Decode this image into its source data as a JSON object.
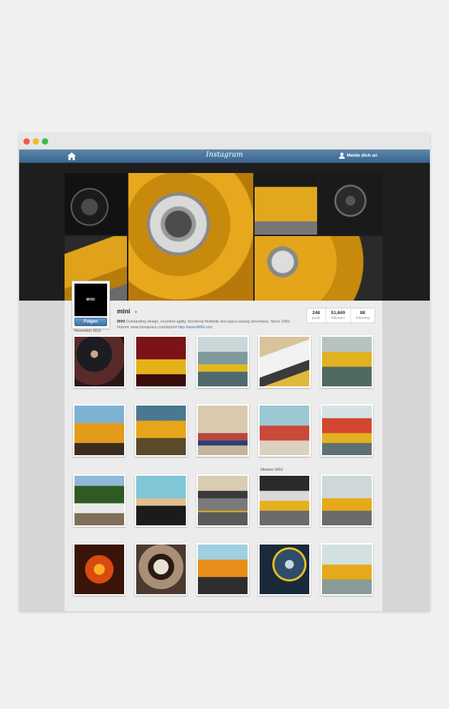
{
  "header": {
    "logo": "Instagram",
    "login_label": "Melde dich an"
  },
  "profile": {
    "username": "mini",
    "avatar_text": "MINI",
    "follow_label": "Folgen",
    "bio_name": "MINI",
    "bio_text": "Outstanding design, excellent agility, functional flexibility and space-saving cleverness. Since 1959. Imprint: www.minispace.com/imprint",
    "bio_link": "http://www.MINI.com"
  },
  "stats": [
    {
      "value": "248",
      "label": "posts"
    },
    {
      "value": "51,669",
      "label": "followers"
    },
    {
      "value": "88",
      "label": "following"
    }
  ],
  "months": [
    "November 2013",
    "Oktober 2013"
  ],
  "photos": [
    {
      "subject": "man in suit at event"
    },
    {
      "subject": "yellow MINI on red stage"
    },
    {
      "subject": "yellow MINI in hall"
    },
    {
      "subject": "MINI sign with chairs"
    },
    {
      "subject": "yellow MINIs driving"
    },
    {
      "subject": "MINI rear with taillight"
    },
    {
      "subject": "yellow MINI front blurred"
    },
    {
      "subject": "church tower with union jack roof"
    },
    {
      "subject": "#MININOTNORMAL sculpture"
    },
    {
      "subject": "card pyramid MINI Cooper"
    },
    {
      "subject": "white MINI under palm trees"
    },
    {
      "subject": "hula doll on dashboard"
    },
    {
      "subject": "MINI on runway with plane"
    },
    {
      "subject": "MINI in studio with lights"
    },
    {
      "subject": "yellow MINI in showroom"
    },
    {
      "subject": "carved pumpkin with logo"
    },
    {
      "subject": "toy figure close-up"
    },
    {
      "subject": "orange MINI wheel"
    },
    {
      "subject": "MINI key and gauges"
    },
    {
      "subject": "yellow MINI in glass hall"
    }
  ],
  "colors": {
    "header_blue": "#3a6690",
    "follow_blue": "#3f74a4",
    "mini_yellow": "#e5a51a"
  }
}
